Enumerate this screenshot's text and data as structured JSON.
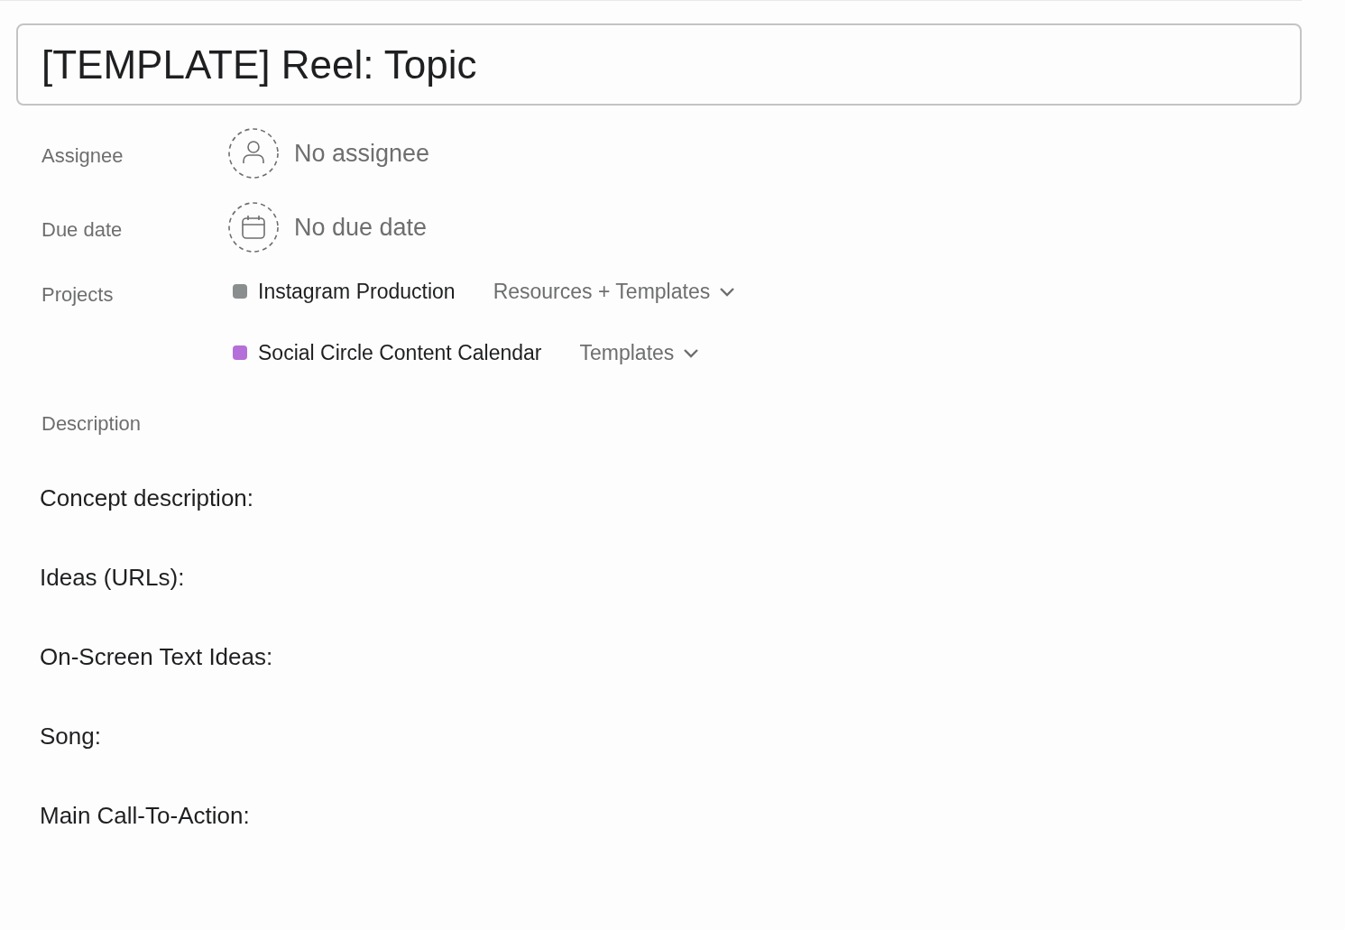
{
  "title": "[TEMPLATE] Reel: Topic",
  "fields": [
    {
      "kind": "assignee",
      "label": "Assignee",
      "value": "No assignee"
    },
    {
      "kind": "date",
      "label": "Due date",
      "value": "No due date"
    }
  ],
  "projects": {
    "label": "Projects",
    "items": [
      {
        "name": "Instagram Production",
        "color": "#8a8e8e",
        "section": "Resources + Templates"
      },
      {
        "name": "Social Circle Content Calendar",
        "color": "#b56fd9",
        "section": "Templates"
      }
    ]
  },
  "description": {
    "label": "Description",
    "lines": [
      "Concept description:",
      "Ideas (URLs):",
      "On-Screen Text Ideas:",
      "Song:",
      "Main Call-To-Action:"
    ]
  }
}
